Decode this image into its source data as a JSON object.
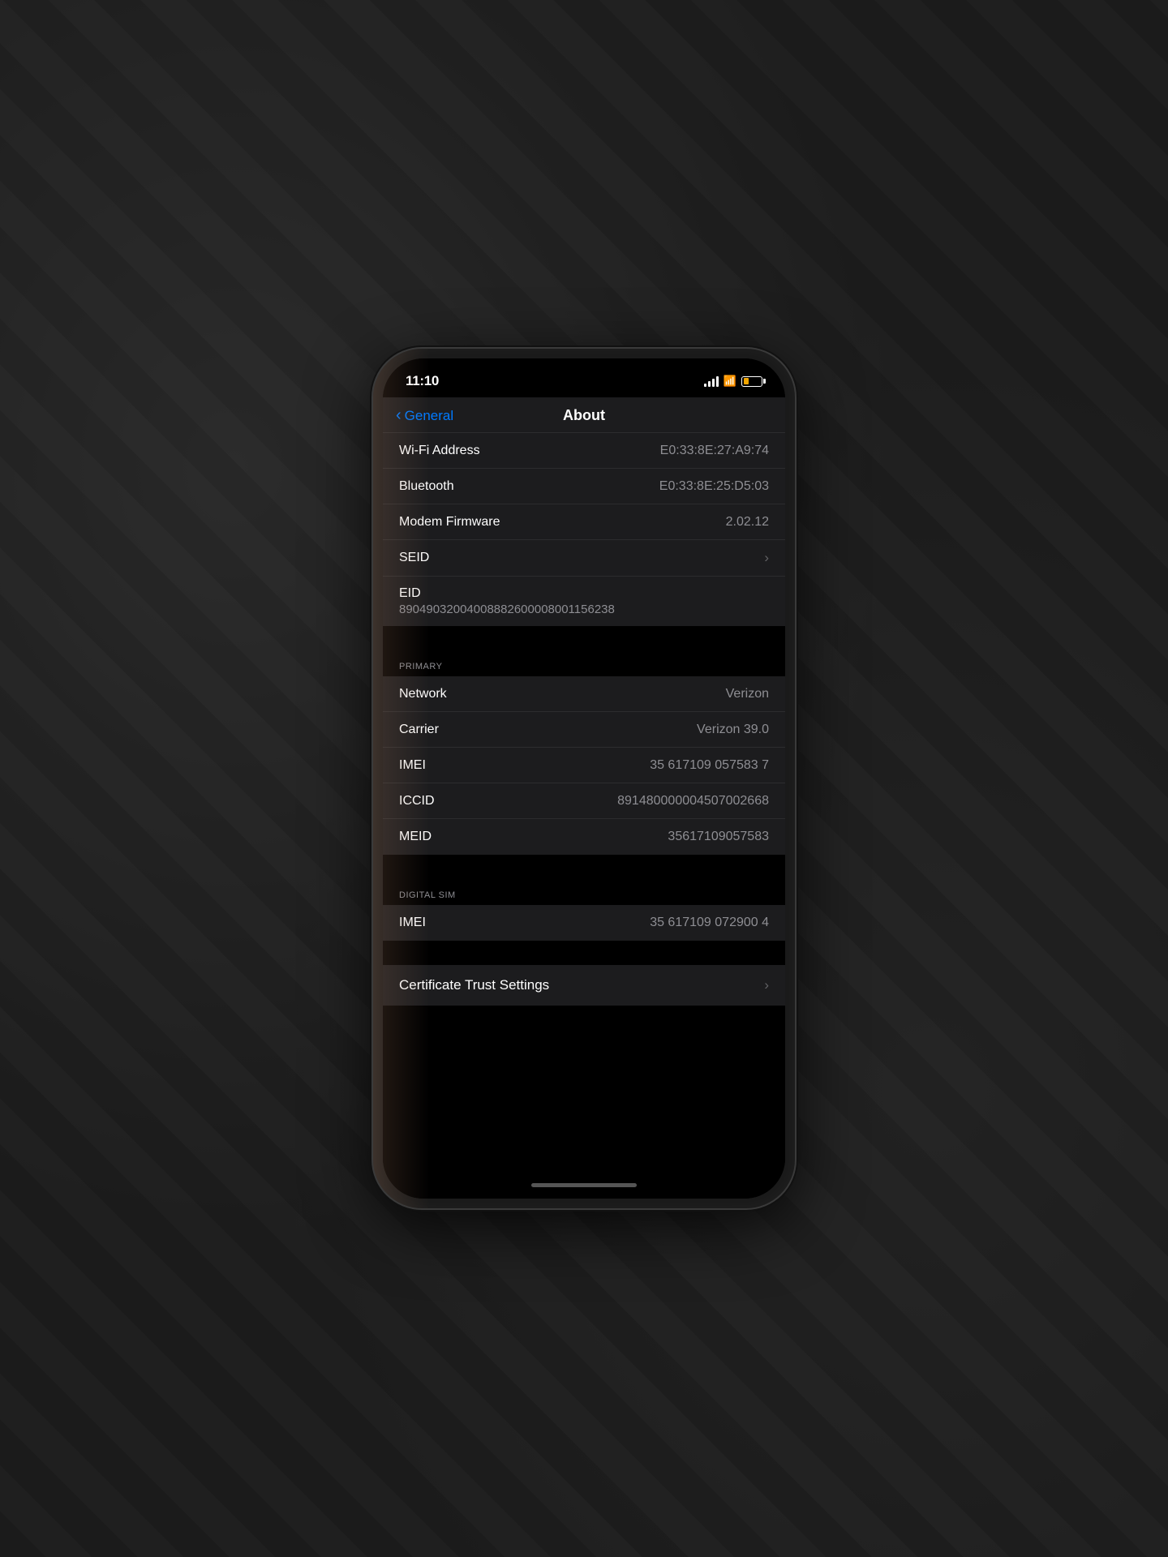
{
  "status_bar": {
    "time": "11:10"
  },
  "nav": {
    "back_label": "General",
    "title": "About"
  },
  "rows": [
    {
      "label": "Wi-Fi Address",
      "value": "E0:33:8E:27:A9:74",
      "type": "normal"
    },
    {
      "label": "Bluetooth",
      "value": "E0:33:8E:25:D5:03",
      "type": "normal"
    },
    {
      "label": "Modem Firmware",
      "value": "2.02.12",
      "type": "normal"
    },
    {
      "label": "SEID",
      "value": "",
      "type": "chevron"
    },
    {
      "label": "EID",
      "value": "89049032004008882600008001156238",
      "type": "full"
    }
  ],
  "sections": {
    "primary": {
      "label": "PRIMARY",
      "rows": [
        {
          "label": "Network",
          "value": "Verizon"
        },
        {
          "label": "Carrier",
          "value": "Verizon 39.0"
        },
        {
          "label": "IMEI",
          "value": "35 617109 057583 7"
        },
        {
          "label": "ICCID",
          "value": "891480000004507002668"
        },
        {
          "label": "MEID",
          "value": "35617109057583"
        }
      ]
    },
    "digital_sim": {
      "label": "DIGITAL SIM",
      "rows": [
        {
          "label": "IMEI",
          "value": "35 617109 072900 4"
        }
      ]
    }
  },
  "certificate_trust": {
    "label": "Certificate Trust Settings"
  }
}
